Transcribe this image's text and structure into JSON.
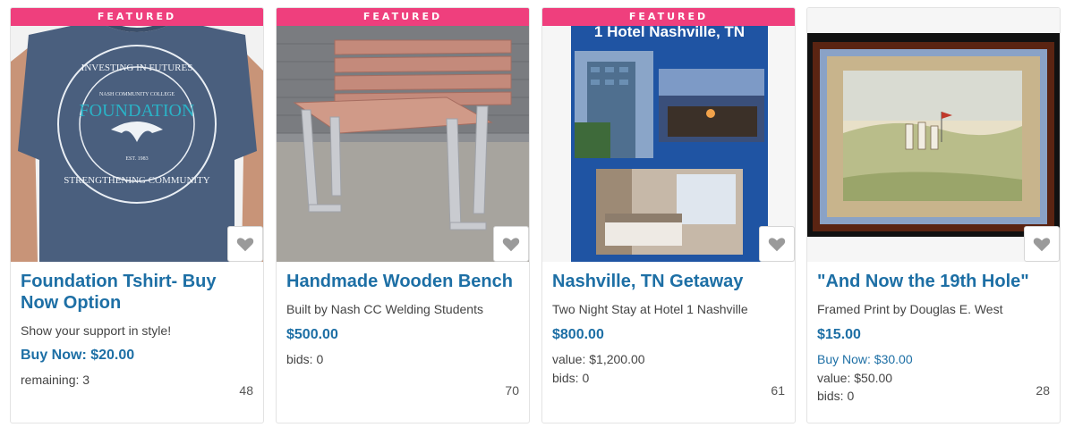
{
  "colors": {
    "accent": "#1d6fa5",
    "featured": "#ef3f7d"
  },
  "cards": [
    {
      "featured": "FEATURED",
      "shirt_text": {
        "top": "INVESTING IN FUTURES",
        "college": "NASH COMMUNITY COLLEGE",
        "word": "FOUNDATION",
        "est": "EST. 1983",
        "bottom": "STRENGTHENING COMMUNITY"
      },
      "title_line1": "Foundation Tshirt- Buy",
      "title_line2": "Now Option",
      "subtitle": "Show your support in style!",
      "buy_now": "Buy Now: $20.00",
      "remaining": "remaining: 3",
      "count": "48",
      "heart_icon": "heart-icon"
    },
    {
      "featured": "FEATURED",
      "title": "Handmade Wooden Bench",
      "subtitle": "Built by Nash CC Welding Students",
      "price": "$500.00",
      "bids": "bids: 0",
      "count": "70",
      "heart_icon": "heart-icon"
    },
    {
      "featured": "FEATURED",
      "image_title": "1 Hotel Nashville, TN",
      "title": "Nashville, TN Getaway",
      "subtitle": "Two Night Stay at Hotel 1 Nashville",
      "price": "$800.00",
      "value": "value: $1,200.00",
      "bids": "bids: 0",
      "count": "61",
      "heart_icon": "heart-icon"
    },
    {
      "title": "\"And Now the 19th Hole\"",
      "subtitle": "Framed Print by Douglas E. West",
      "price": "$15.00",
      "buy_now": "Buy Now: $30.00",
      "value": "value: $50.00",
      "bids": "bids: 0",
      "count": "28",
      "heart_icon": "heart-icon"
    }
  ]
}
